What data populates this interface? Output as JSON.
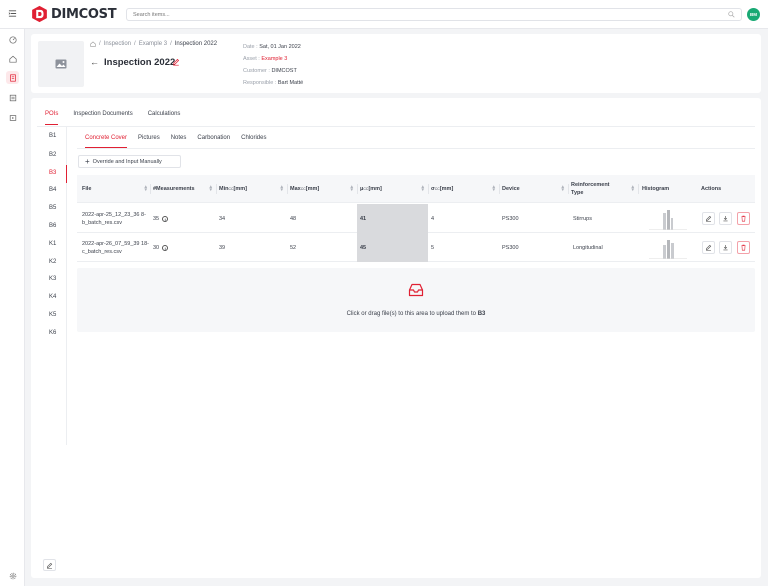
{
  "app": {
    "logo_text": "DIMCOST",
    "user_initials": "BM",
    "brand_color": "#e02033",
    "avatar_color": "#19a974"
  },
  "search": {
    "placeholder": "Search items..."
  },
  "sidebar_icons": [
    "menu-icon",
    "dashboard-icon",
    "home-icon",
    "bookmark-icon",
    "book-icon",
    "video-icon",
    "settings-icon"
  ],
  "breadcrumb": {
    "items": [
      "Inspection",
      "Example 3",
      "Inspection 2022"
    ]
  },
  "inspection": {
    "title": "Inspection 2022",
    "date_label": "Date :",
    "date": "Sat, 01 Jan 2022",
    "asset_label": "Asset :",
    "asset": "Example 3",
    "customer_label": "Customer :",
    "customer": "DIMCOST",
    "responsible_label": "Responsible :",
    "responsible": "Bart Matté"
  },
  "tabs": [
    "POIs",
    "Inspection Documents",
    "Calculations"
  ],
  "pois": [
    "B1",
    "B2",
    "B3",
    "B4",
    "B5",
    "B6",
    "K1",
    "K2",
    "K3",
    "K4",
    "K5",
    "K6"
  ],
  "active_poi": "B3",
  "subtabs": [
    "Concrete Cover",
    "Pictures",
    "Notes",
    "Carbonation",
    "Chlorides"
  ],
  "override_button": "Override and Input Manually",
  "table": {
    "headers": {
      "file": "File",
      "measurements": "#Measurements",
      "min": "Min",
      "min_sub": "CC",
      "min_unit": " [mm]",
      "max": "Max",
      "max_sub": "CC",
      "max_unit": " [mm]",
      "mu": "μ",
      "mu_sub": "CC",
      "mu_unit": " [mm]",
      "sigma": "σ",
      "sigma_sub": "CC",
      "sigma_unit": " [mm]",
      "device": "Device",
      "reinf_type": "Reinforcement Type",
      "histogram": "Histogram",
      "actions": "Actions"
    },
    "rows": [
      {
        "file": "2022-apr-25_12_23_36 8-b_batch_res.csv",
        "measurements": "35",
        "min": "34",
        "max": "48",
        "mu": "41",
        "sigma": "4",
        "device": "PS300",
        "reinf_type": "Stirrups"
      },
      {
        "file": "2022-apr-26_07_59_39 18-c_batch_res.csv",
        "measurements": "30",
        "min": "39",
        "max": "52",
        "mu": "45",
        "sigma": "5",
        "device": "PS300",
        "reinf_type": "Longitudinal"
      }
    ]
  },
  "dropzone": {
    "text": "Click or drag file(s) to this area to upload them to ",
    "target": "B3"
  }
}
